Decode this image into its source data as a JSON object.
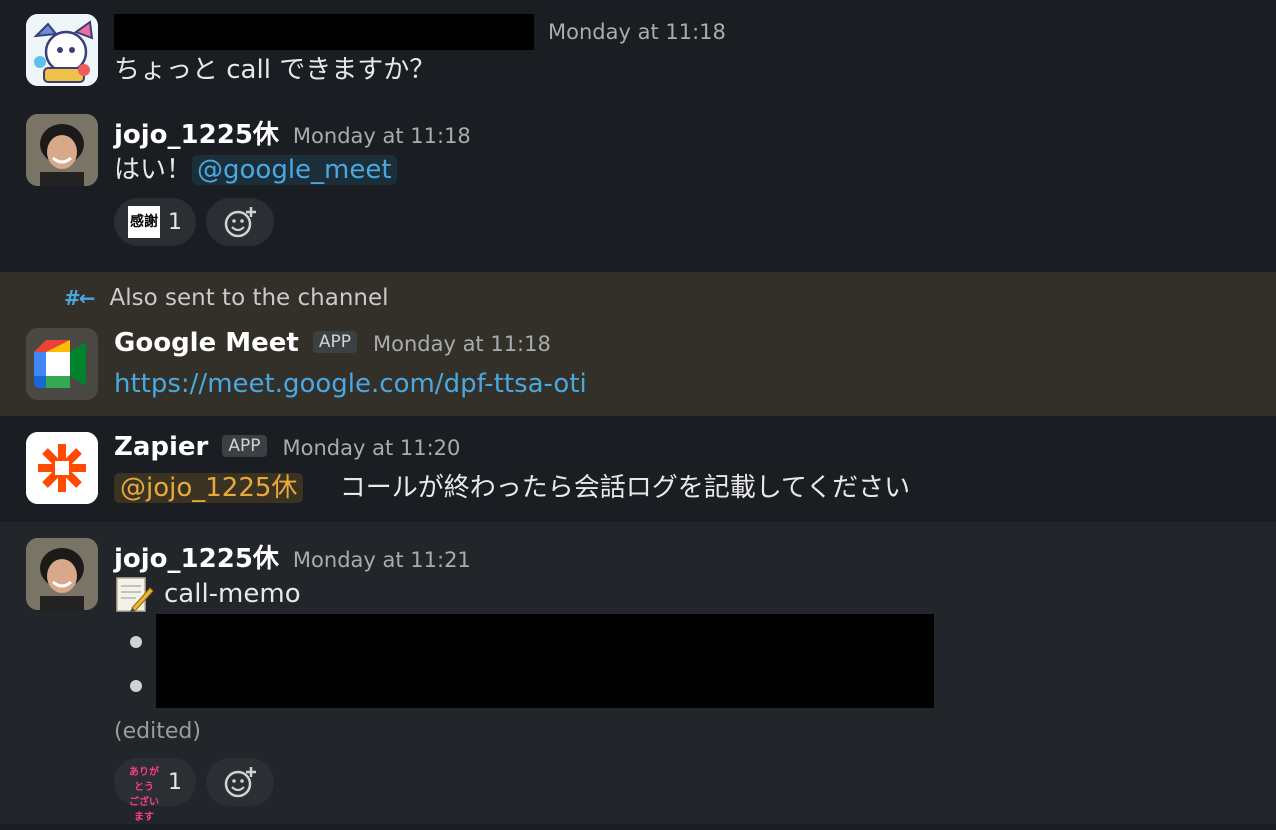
{
  "messages": {
    "m1": {
      "time": "Monday at 11:18",
      "text": "ちょっと call できますか？"
    },
    "m2": {
      "author": "jojo_1225休",
      "time": "Monday at 11:18",
      "text": "はい！",
      "mention": "@google_meet",
      "reaction": {
        "emoji_text": "感謝",
        "count": "1"
      }
    },
    "also_sent": "Also sent to the channel",
    "m3": {
      "author": "Google Meet",
      "badge": "APP",
      "time": "Monday at 11:18",
      "link": "https://meet.google.com/dpf-ttsa-oti"
    },
    "m4": {
      "author": "Zapier",
      "badge": "APP",
      "time": "Monday at 11:20",
      "mention": "@jojo_1225休",
      "text": "コールが終わったら会話ログを記載してください"
    },
    "m5": {
      "author": "jojo_1225休",
      "time": "Monday at 11:21",
      "title": "call-memo",
      "edited": "(edited)",
      "reaction": {
        "emoji_text_1": "ありがとう",
        "emoji_text_2": "ございます",
        "count": "1"
      }
    }
  },
  "colors": {
    "background": "#1a1d21",
    "highlight_row": "#332f29",
    "link": "#4aa8e0",
    "mention_yellow": "#e8a93c"
  },
  "icons": [
    "memo-icon",
    "add-reaction-icon",
    "hash-channel-icon",
    "google-meet-logo",
    "zapier-logo"
  ]
}
